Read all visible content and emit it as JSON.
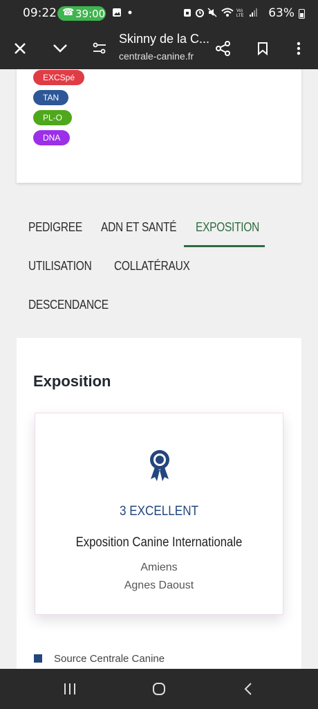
{
  "status_bar": {
    "time": "09:22",
    "call_duration": "39:00",
    "battery_percent": "63%",
    "network": "Vo) LTE"
  },
  "toolbar": {
    "title": "Skinny de la C...",
    "url": "centrale-canine.fr"
  },
  "badges": [
    {
      "label": "EXCSpé",
      "color": "#e03c45"
    },
    {
      "label": "TAN",
      "color": "#2d5797"
    },
    {
      "label": "PL-O",
      "color": "#4fa81b"
    },
    {
      "label": "DNA",
      "color": "#9b30e8"
    }
  ],
  "tabs": [
    {
      "label": "PEDIGREE"
    },
    {
      "label": "ADN ET SANTÉ"
    },
    {
      "label": "EXPOSITION"
    },
    {
      "label": "UTILISATION"
    },
    {
      "label": "COLLATÉRAUX"
    },
    {
      "label": "DESCENDANCE"
    }
  ],
  "active_tab": "EXPOSITION",
  "exposition": {
    "heading": "Exposition",
    "result": {
      "rank": "3 EXCELLENT",
      "event": "Exposition Canine Internationale",
      "city": "Amiens",
      "judge": "Agnes Daoust"
    },
    "source": "Source Centrale Canine"
  },
  "colors": {
    "accent_green": "#2e6b3f",
    "accent_blue": "#23467d",
    "system_bar": "#2a2a2a"
  }
}
